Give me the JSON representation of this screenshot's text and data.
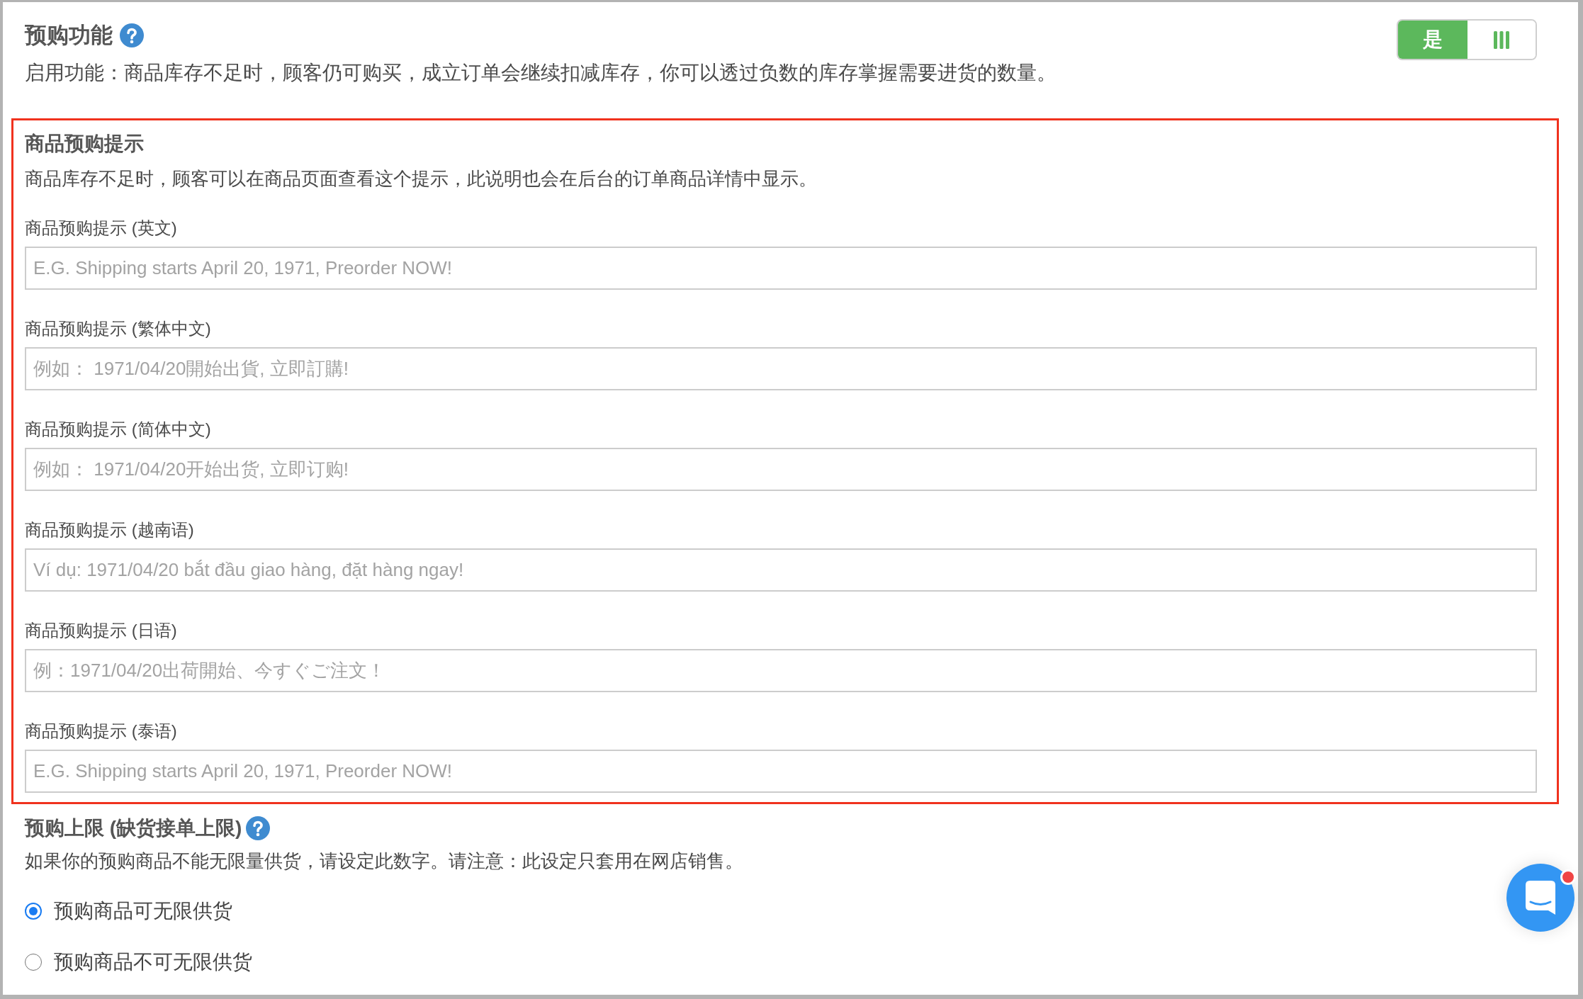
{
  "preorder": {
    "title": "预购功能",
    "description": "启用功能：商品库存不足时，顾客仍可购买，成立订单会继续扣减库存，你可以透过负数的库存掌握需要进货的数量。",
    "toggle": {
      "label": "是",
      "on": true
    }
  },
  "message_section": {
    "highlighted": true,
    "title": "商品预购提示",
    "description": "商品库存不足时，顾客可以在商品页面查看这个提示，此说明也会在后台的订单商品详情中显示。",
    "fields": [
      {
        "label": "商品预购提示 (英文)",
        "placeholder": "E.G. Shipping starts April 20, 1971, Preorder NOW!"
      },
      {
        "label": "商品预购提示 (繁体中文)",
        "placeholder": "例如： 1971/04/20開始出貨, 立即訂購!"
      },
      {
        "label": "商品预购提示 (简体中文)",
        "placeholder": "例如： 1971/04/20开始出货, 立即订购!"
      },
      {
        "label": "商品预购提示 (越南语)",
        "placeholder": "Ví dụ: 1971/04/20 bắt đầu giao hàng, đặt hàng ngay!"
      },
      {
        "label": "商品预购提示 (日语)",
        "placeholder": "例：1971/04/20出荷開始、今すぐご注文！"
      },
      {
        "label": "商品预购提示 (泰语)",
        "placeholder": "E.G. Shipping starts April 20, 1971, Preorder NOW!"
      }
    ]
  },
  "limit_section": {
    "title": "预购上限 (缺货接单上限)",
    "description": "如果你的预购商品不能无限量供货，请设定此数字。请注意：此设定只套用在网店销售。",
    "options": [
      {
        "label": "预购商品可无限供货",
        "selected": true
      },
      {
        "label": "预购商品不可无限供货",
        "selected": false
      }
    ]
  },
  "chat_button": {
    "notification": true
  }
}
